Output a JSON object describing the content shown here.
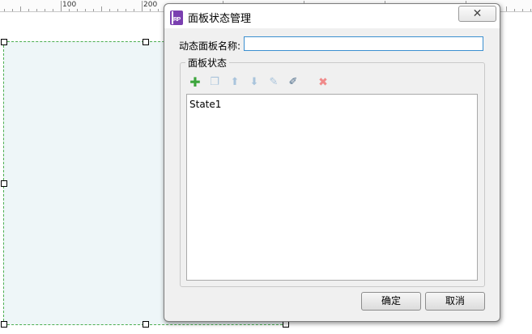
{
  "ruler": {
    "labels": [
      "100",
      "200"
    ]
  },
  "dialog": {
    "title": "面板状态管理",
    "app_icon_text": "RP",
    "close_symbol": "✕",
    "name_label": "动态面板名称:",
    "name_value": "",
    "group_label": "面板状态",
    "toolbar": {
      "add": "add-state",
      "duplicate": "duplicate-state",
      "move_up": "move-up",
      "move_down": "move-down",
      "edit": "edit-state",
      "edit_all": "edit-all-states",
      "delete": "delete-state"
    },
    "states": [
      "State1"
    ],
    "ok_label": "确定",
    "cancel_label": "取消"
  },
  "colors": {
    "widget_fill": "#eef6f8",
    "selection_dash": "#4caf50",
    "input_focus": "#3b8fd0",
    "app_icon": "#7a3fb0",
    "add_icon": "#3ca53c",
    "delete_icon": "#f08a8a"
  }
}
